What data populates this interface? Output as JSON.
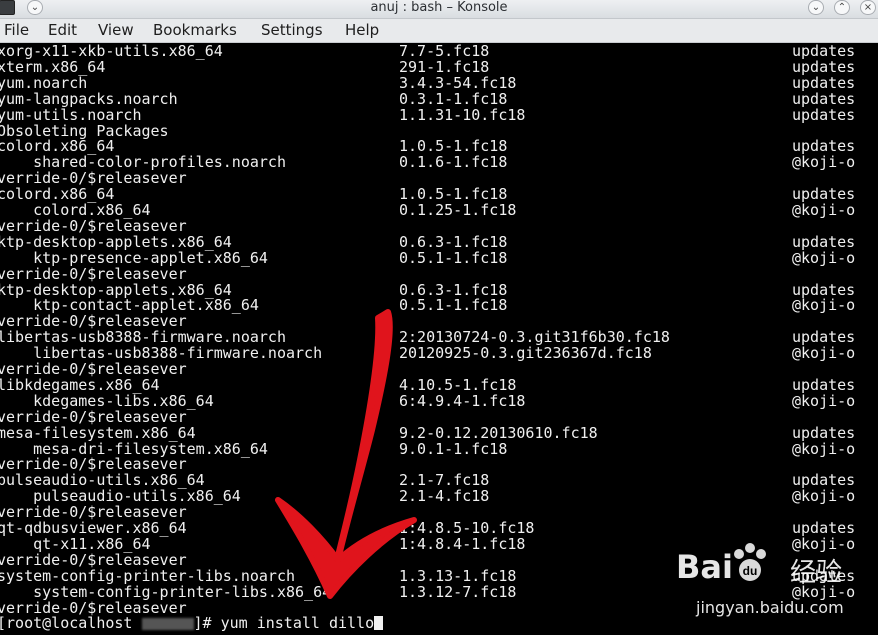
{
  "window": {
    "title": "anuj : bash – Konsole"
  },
  "menu": [
    "File",
    "Edit",
    "View",
    "Bookmarks",
    "Settings",
    "Help"
  ],
  "rows": [
    {
      "pkg": "xorg-x11-xkb-utils.x86_64",
      "ver": "7.7-5.fc18",
      "repo": "updates"
    },
    {
      "pkg": "xterm.x86_64",
      "ver": "291-1.fc18",
      "repo": "updates"
    },
    {
      "pkg": "yum.noarch",
      "ver": "3.4.3-54.fc18",
      "repo": "updates"
    },
    {
      "pkg": "yum-langpacks.noarch",
      "ver": "0.3.1-1.fc18",
      "repo": "updates"
    },
    {
      "pkg": "yum-utils.noarch",
      "ver": "1.1.31-10.fc18",
      "repo": "updates"
    },
    {
      "pkg": "Obsoleting Packages",
      "ver": "",
      "repo": ""
    },
    {
      "pkg": "colord.x86_64",
      "ver": "1.0.5-1.fc18",
      "repo": "updates"
    },
    {
      "pkg": "    shared-color-profiles.noarch",
      "ver": "0.1.6-1.fc18",
      "repo": "@koji-o"
    },
    {
      "pkg": "verride-0/$releasever",
      "ver": "",
      "repo": ""
    },
    {
      "pkg": "colord.x86_64",
      "ver": "1.0.5-1.fc18",
      "repo": "updates"
    },
    {
      "pkg": "    colord.x86_64",
      "ver": "0.1.25-1.fc18",
      "repo": "@koji-o"
    },
    {
      "pkg": "verride-0/$releasever",
      "ver": "",
      "repo": ""
    },
    {
      "pkg": "ktp-desktop-applets.x86_64",
      "ver": "0.6.3-1.fc18",
      "repo": "updates"
    },
    {
      "pkg": "    ktp-presence-applet.x86_64",
      "ver": "0.5.1-1.fc18",
      "repo": "@koji-o"
    },
    {
      "pkg": "verride-0/$releasever",
      "ver": "",
      "repo": ""
    },
    {
      "pkg": "ktp-desktop-applets.x86_64",
      "ver": "0.6.3-1.fc18",
      "repo": "updates"
    },
    {
      "pkg": "    ktp-contact-applet.x86_64",
      "ver": "0.5.1-1.fc18",
      "repo": "@koji-o"
    },
    {
      "pkg": "verride-0/$releasever",
      "ver": "",
      "repo": ""
    },
    {
      "pkg": "libertas-usb8388-firmware.noarch",
      "ver": "2:20130724-0.3.git31f6b30.fc18",
      "repo": "updates"
    },
    {
      "pkg": "    libertas-usb8388-firmware.noarch",
      "ver": "20120925-0.3.git236367d.fc18",
      "repo": "@koji-o"
    },
    {
      "pkg": "verride-0/$releasever",
      "ver": "",
      "repo": ""
    },
    {
      "pkg": "libkdegames.x86_64",
      "ver": "4.10.5-1.fc18",
      "repo": "updates"
    },
    {
      "pkg": "    kdegames-libs.x86_64",
      "ver": "6:4.9.4-1.fc18",
      "repo": "@koji-o"
    },
    {
      "pkg": "verride-0/$releasever",
      "ver": "",
      "repo": ""
    },
    {
      "pkg": "mesa-filesystem.x86_64",
      "ver": "9.2-0.12.20130610.fc18",
      "repo": "updates"
    },
    {
      "pkg": "    mesa-dri-filesystem.x86_64",
      "ver": "9.0.1-1.fc18",
      "repo": "@koji-o"
    },
    {
      "pkg": "verride-0/$releasever",
      "ver": "",
      "repo": ""
    },
    {
      "pkg": "pulseaudio-utils.x86_64",
      "ver": "2.1-7.fc18",
      "repo": "updates"
    },
    {
      "pkg": "    pulseaudio-utils.x86_64",
      "ver": "2.1-4.fc18",
      "repo": "@koji-o"
    },
    {
      "pkg": "verride-0/$releasever",
      "ver": "",
      "repo": ""
    },
    {
      "pkg": "qt-qdbusviewer.x86_64",
      "ver": "1:4.8.5-10.fc18",
      "repo": "updates"
    },
    {
      "pkg": "    qt-x11.x86_64",
      "ver": "1:4.8.4-1.fc18",
      "repo": "@koji-o"
    },
    {
      "pkg": "verride-0/$releasever",
      "ver": "",
      "repo": ""
    },
    {
      "pkg": "system-config-printer-libs.noarch",
      "ver": "1.3.13-1.fc18",
      "repo": "updates"
    },
    {
      "pkg": "    system-config-printer-libs.x86_64",
      "ver": "1.3.12-7.fc18",
      "repo": "@koji-o"
    },
    {
      "pkg": "verride-0/$releasever",
      "ver": "",
      "repo": ""
    }
  ],
  "prompt": {
    "prefix": "[root@localhost ",
    "suffix": "]# yum install dillo"
  },
  "watermark": {
    "brand": "Bai",
    "brand_suffix": "经验",
    "paw_glyph": "du",
    "url": "jingyan.baidu.com"
  },
  "colors": {
    "terminal_bg": "#000000",
    "terminal_fg": "#f0f0f0",
    "arrow": "#e0141c"
  },
  "icons": {
    "window": "konsole-icon",
    "minimize": "chevron-down-icon",
    "maximize": "chevron-up-icon",
    "close": "close-icon"
  }
}
